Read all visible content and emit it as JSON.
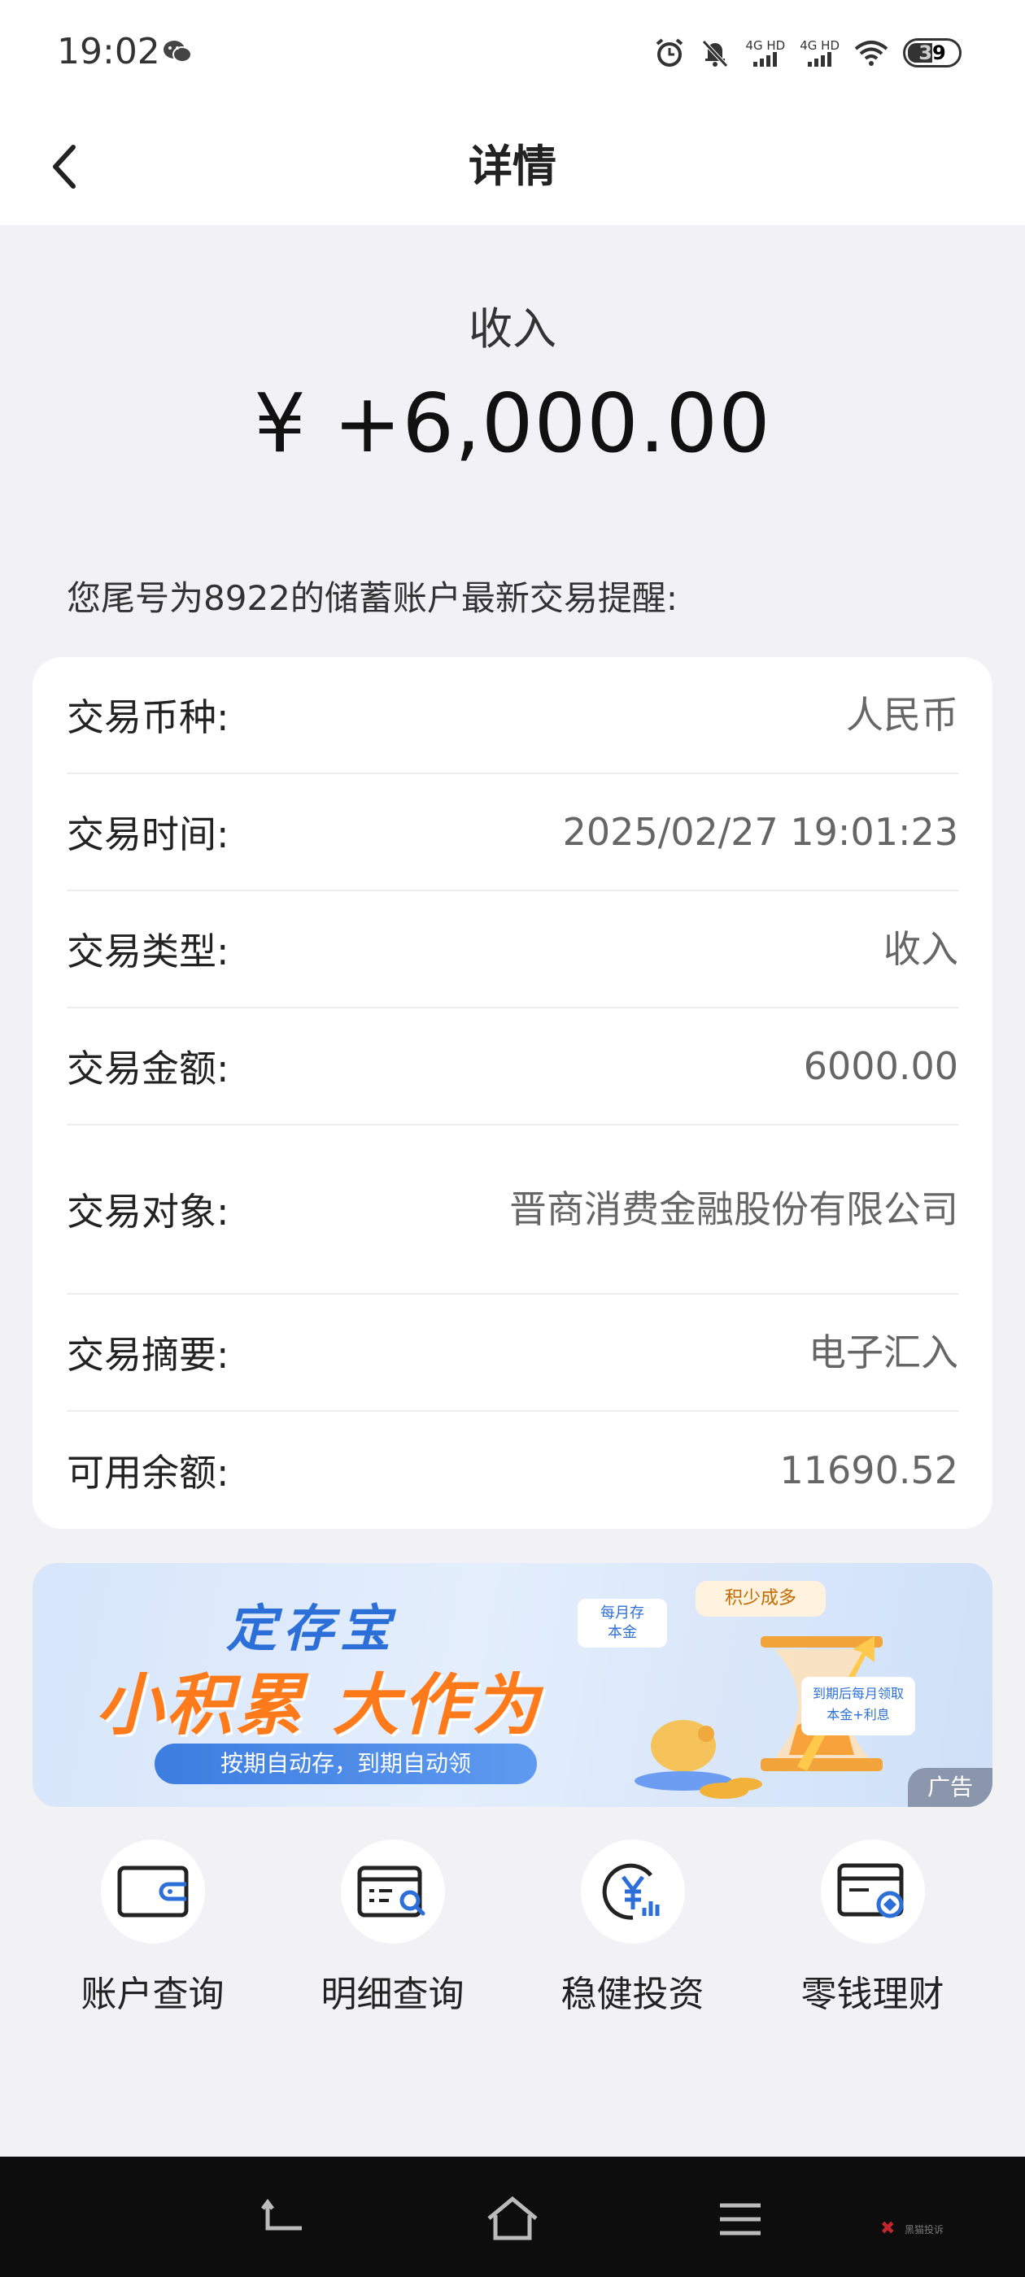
{
  "status_bar": {
    "time": "19:02",
    "signal1": "4G HD",
    "signal2": "4G HD",
    "battery": "39",
    "icons": [
      "wechat-icon",
      "alarm-icon",
      "mute-icon",
      "signal-icon",
      "wifi-icon",
      "battery-icon"
    ]
  },
  "header": {
    "title": "详情",
    "back_icon": "chevron-left-icon"
  },
  "summary": {
    "type": "收入",
    "amount": "¥ +6,000.00"
  },
  "notice": "您尾号为8922的储蓄账户最新交易提醒:",
  "details": [
    {
      "label": "交易币种:",
      "value": "人民币"
    },
    {
      "label": "交易时间:",
      "value": "2025/02/27 19:01:23"
    },
    {
      "label": "交易类型:",
      "value": "收入"
    },
    {
      "label": "交易金额:",
      "value": "6000.00"
    },
    {
      "label": "交易对象:",
      "value": "晋商消费金融股份有限公司"
    },
    {
      "label": "交易摘要:",
      "value": "电子汇入"
    },
    {
      "label": "可用余额:",
      "value": "11690.52"
    }
  ],
  "banner": {
    "title1": "定存宝",
    "title2": "小积累 大作为",
    "subtitle": "按期自动存，到期自动领",
    "tag1_line1": "每月存",
    "tag1_line2": "本金",
    "tag2": "积少成多",
    "tag3_line1": "到期后每月领取",
    "tag3_line2": "本金+利息",
    "ad_label": "广告"
  },
  "actions": [
    {
      "label": "账户查询",
      "icon": "wallet-icon"
    },
    {
      "label": "明细查询",
      "icon": "statement-search-icon"
    },
    {
      "label": "稳健投资",
      "icon": "yuan-invest-icon"
    },
    {
      "label": "零钱理财",
      "icon": "card-finance-icon"
    }
  ],
  "nav_bar": {
    "buttons": [
      "back-nav-icon",
      "home-icon",
      "menu-icon"
    ],
    "extra_text": "黑猫投诉"
  },
  "colors": {
    "page_bg": "#f2f2f4",
    "card_bg": "#ffffff",
    "accent_blue": "#2d6fd8",
    "accent_orange": "#ff7a1a"
  }
}
